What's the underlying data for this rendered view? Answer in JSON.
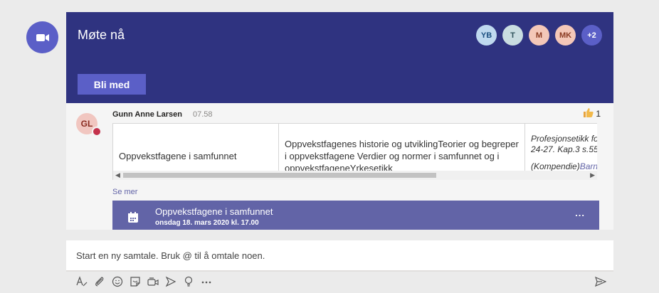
{
  "meeting": {
    "title": "Møte nå",
    "join_label": "Bli med",
    "participants": [
      {
        "initials": "YB",
        "bg": "#bfd9ef",
        "fg": "#1b4f80"
      },
      {
        "initials": "T",
        "bg": "#c9dde1",
        "fg": "#30545c"
      },
      {
        "initials": "M",
        "bg": "#f4c7b8",
        "fg": "#8a3a22"
      },
      {
        "initials": "MK",
        "bg": "#f4c7b8",
        "fg": "#8a3a22"
      },
      {
        "initials": "+2",
        "bg": "#5b5fc7",
        "fg": "#ffffff"
      }
    ]
  },
  "message": {
    "avatar_initials": "GL",
    "author": "Gunn Anne Larsen",
    "time": "07.58",
    "reaction_count": "1",
    "table": {
      "col1": "Oppvekstfagene i samfunnet",
      "col2": "Oppvekstfagenes historie og utviklingTeorier og begreper i oppvekstfagene Verdier og normer i samfunnet og i oppvekstfageneYrkesetikk",
      "col3_line1": "Profesjonsetikk fo",
      "col3_line2": "24-27. Kap.3 s.55",
      "col3_line3_prefix": "(Kompendie)",
      "col3_line3_link": "Barn"
    },
    "see_more": "Se mer"
  },
  "event": {
    "title": "Oppvekstfagene i samfunnet",
    "date": "onsdag 18. mars 2020 kl. 17.00",
    "more": "..."
  },
  "compose": {
    "placeholder": "Start en ny samtale. Bruk @ til å omtale noen."
  },
  "toolbar": {
    "icons": [
      "format-icon",
      "attach-icon",
      "emoji-icon",
      "sticker-icon",
      "meet-now-icon",
      "praise-icon",
      "lightbulb-icon",
      "more-icon"
    ]
  },
  "colors": {
    "meeting_bg": "#2f3380",
    "accent": "#5b5fc7",
    "event_bg": "#6264a7",
    "status_busy": "#c4314b"
  }
}
